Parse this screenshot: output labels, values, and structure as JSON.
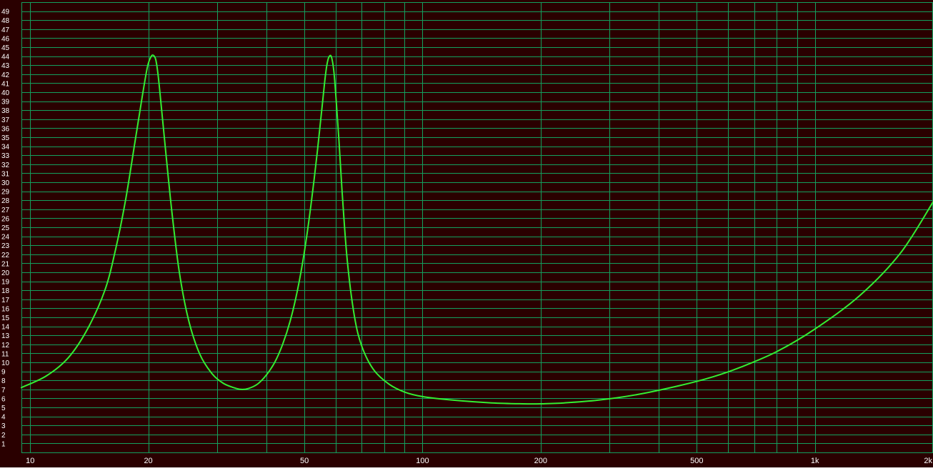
{
  "chart_data": {
    "type": "line",
    "title": "",
    "xlabel": "",
    "ylabel": "",
    "x_scale": "log",
    "xlim": [
      9.5,
      2000
    ],
    "ylim": [
      0,
      50
    ],
    "grid": true,
    "x_tick_labels": [
      {
        "value": 10,
        "label": "10"
      },
      {
        "value": 20,
        "label": "20"
      },
      {
        "value": 50,
        "label": "50"
      },
      {
        "value": 100,
        "label": "100"
      },
      {
        "value": 200,
        "label": "200"
      },
      {
        "value": 500,
        "label": "500"
      },
      {
        "value": 1000,
        "label": "1k"
      },
      {
        "value": 2000,
        "label": "2k"
      }
    ],
    "x_minor_gridlines": [
      30,
      40,
      60,
      70,
      80,
      90,
      300,
      400,
      600,
      700,
      800,
      900
    ],
    "y_tick_labels": [
      "1",
      "2",
      "3",
      "4",
      "5",
      "6",
      "7",
      "8",
      "9",
      "10",
      "11",
      "12",
      "13",
      "14",
      "15",
      "16",
      "17",
      "18",
      "19",
      "20",
      "21",
      "22",
      "23",
      "24",
      "25",
      "26",
      "27",
      "28",
      "29",
      "30",
      "31",
      "32",
      "33",
      "34",
      "35",
      "36",
      "37",
      "38",
      "39",
      "40",
      "41",
      "42",
      "43",
      "44",
      "45",
      "46",
      "47",
      "48",
      "49"
    ],
    "series": [
      {
        "color": "#33ee33",
        "x": [
          9.5,
          11,
          12.5,
          14,
          15.5,
          16.5,
          17.5,
          18.5,
          19.3,
          19.9,
          20.3,
          20.6,
          20.9,
          21.2,
          21.6,
          22.2,
          23,
          24,
          25.3,
          27,
          29,
          31,
          33,
          34.5,
          36,
          38,
          40,
          42,
          44,
          46,
          48,
          50,
          52,
          54,
          55.5,
          56.5,
          57.2,
          57.9,
          58.6,
          59.4,
          60.2,
          61.2,
          62.5,
          64.3,
          67,
          70,
          75,
          82,
          90,
          100,
          120,
          150,
          180,
          200,
          230,
          280,
          350,
          450,
          550,
          650,
          800,
          1000,
          1300,
          1650,
          2000
        ],
        "y": [
          7.2,
          8.5,
          10.5,
          13.7,
          18.0,
          22.5,
          28.0,
          34.5,
          39.5,
          42.8,
          43.9,
          44.1,
          43.6,
          41.8,
          38.3,
          33.0,
          26.5,
          20.0,
          14.8,
          11.0,
          8.8,
          7.7,
          7.2,
          7.0,
          7.1,
          7.6,
          8.6,
          10.0,
          12.0,
          14.6,
          18.0,
          22.3,
          27.6,
          33.6,
          38.5,
          41.7,
          43.3,
          44.0,
          43.9,
          42.4,
          39.3,
          34.8,
          28.4,
          21.3,
          15.2,
          11.8,
          9.2,
          7.6,
          6.7,
          6.2,
          5.8,
          5.5,
          5.4,
          5.4,
          5.5,
          5.8,
          6.4,
          7.4,
          8.4,
          9.5,
          11.2,
          13.7,
          17.4,
          22.1,
          27.8
        ]
      }
    ],
    "colors": {
      "background": "#2a0000",
      "grid": "#13a05e",
      "axis_labels": "#ffffff",
      "curve": "#33ee33"
    }
  }
}
